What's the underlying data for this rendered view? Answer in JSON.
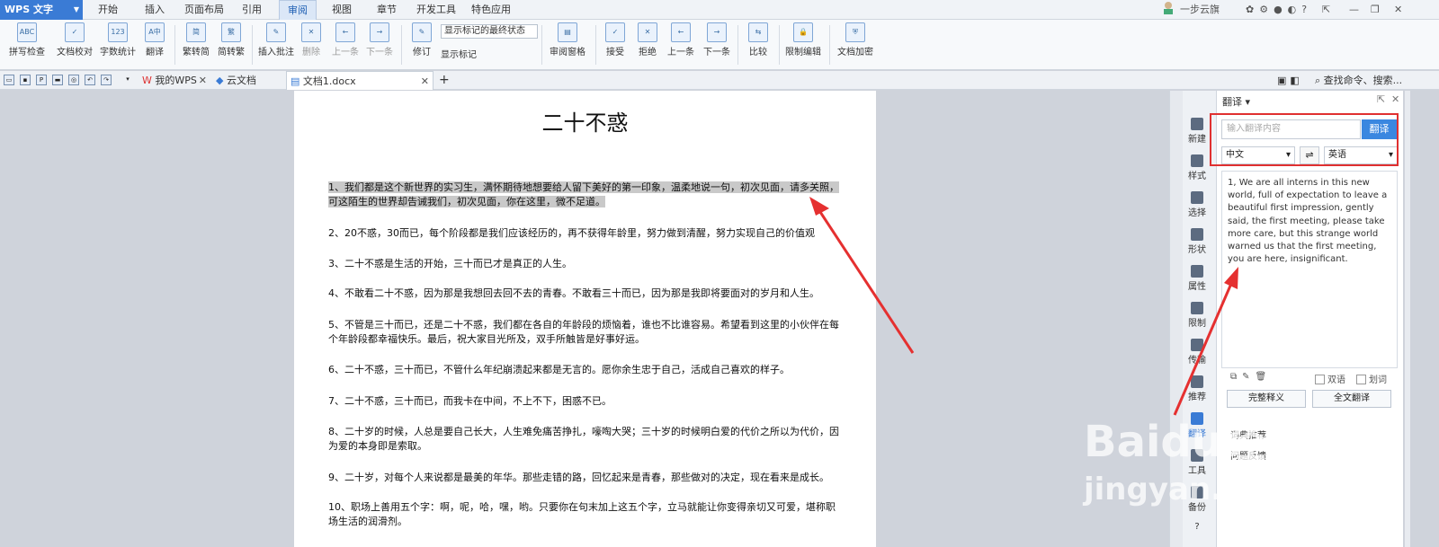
{
  "app": {
    "name": "WPS 文字"
  },
  "menu": {
    "tabs": [
      "开始",
      "插入",
      "页面布局",
      "引用",
      "审阅",
      "视图",
      "章节",
      "开发工具",
      "特色应用"
    ],
    "active": "审阅",
    "account": "一步云旗"
  },
  "ribbon": {
    "buttons": [
      "拼写检查",
      "文档校对",
      "字数统计",
      "翻译",
      "繁转简",
      "简转繁",
      "插入批注",
      "删除",
      "上一条",
      "下一条",
      "修订",
      "显示标记",
      "审阅窗格",
      "接受",
      "拒绝",
      "上一条",
      "下一条",
      "比较",
      "限制编辑",
      "文档加密"
    ],
    "markup_state": "显示标记的最终状态"
  },
  "doctabs": {
    "tabs": [
      "我的WPS",
      "云文档",
      "文档1.docx"
    ],
    "search": "查找命令、搜索..."
  },
  "document": {
    "title": "二十不惑",
    "paragraphs": [
      "1、我们都是这个新世界的实习生，满怀期待地想要给人留下美好的第一印象，温柔地说一句，初次见面，请多关照，可这陌生的世界却告诫我们，初次见面，你在这里，微不足道。",
      "2、20不惑，30而已，每个阶段都是我们应该经历的，再不获得年龄里，努力做到清醒，努力实现自己的价值观",
      "3、二十不惑是生活的开始，三十而已才是真正的人生。",
      "4、不敢看二十不惑，因为那是我想回去回不去的青春。不敢看三十而已，因为那是我即将要面对的岁月和人生。",
      "5、不管是三十而已，还是二十不惑，我们都在各自的年龄段的烦恼着，谁也不比谁容易。希望看到这里的小伙伴在每个年龄段都幸福快乐。最后，祝大家目光所及，双手所触皆是好事好运。",
      "6、二十不惑，三十而已，不管什么年纪崩溃起来都是无言的。愿你余生忠于自己，活成自己喜欢的样子。",
      "7、二十不惑，三十而已，而我卡在中间，不上不下，困惑不已。",
      "8、二十岁的时候，人总是要自己长大，人生难免痛苦挣扎，嚎啕大哭；三十岁的时候明白爱的代价之所以为代价，因为爱的本身即是索取。",
      "9、二十岁，对每个人来说都是最美的年华。那些走错的路，回忆起来是青春，那些做对的决定，现在看来是成长。",
      "10、职场上善用五个字：啊，呢，哈，嘿，哟。只要你在句末加上这五个字，立马就能让你变得亲切又可爱，堪称职场生活的润滑剂。"
    ]
  },
  "sidebar": {
    "items": [
      "新建",
      "样式",
      "选择",
      "形状",
      "属性",
      "限制",
      "传输",
      "推荐",
      "翻译",
      "工具",
      "备份"
    ]
  },
  "translate_panel": {
    "title": "翻译",
    "input_placeholder": "输入翻译内容",
    "translate_button": "翻译",
    "source_lang": "中文",
    "target_lang": "英语",
    "result": "1, We are all interns in this new world, full of expectation to leave a beautiful first impression, gently said, the first meeting, please take more care, but this strange world warned us that the first meeting, you are here, insignificant.",
    "bilingual_label": "双语",
    "word_select_label": "划词",
    "full_definition_button": "完整释义",
    "full_translate_button": "全文翻译",
    "extra1": "词典推荐",
    "extra2": "问题反馈"
  },
  "watermark": {
    "brand": "Baidu经验",
    "url": "jingyan.baidu.com"
  },
  "colors": {
    "accent": "#3a7bd5",
    "highlight": "#c9c9c9",
    "annotation": "#e03030"
  }
}
